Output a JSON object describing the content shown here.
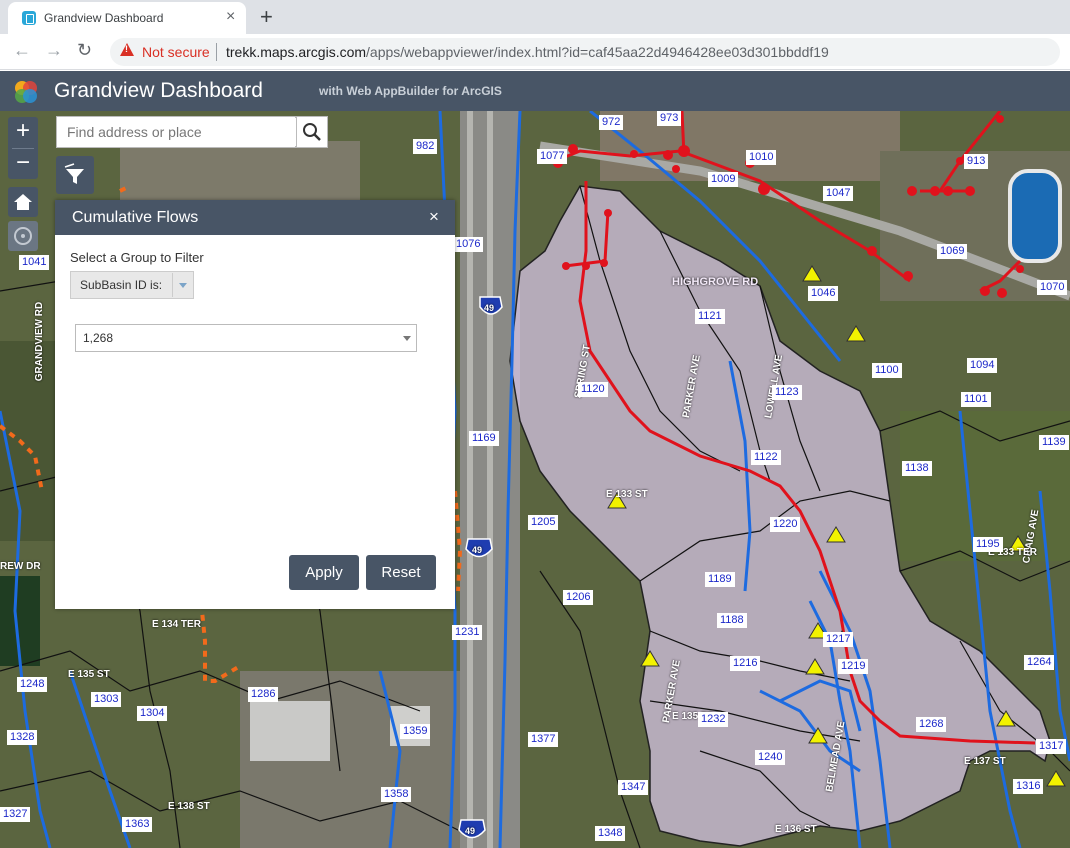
{
  "browser": {
    "tab_title": "Grandview Dashboard",
    "tab_close": "×",
    "new_tab": "+",
    "not_secure": "Not secure",
    "url_host": "trekk.maps.arcgis.com",
    "url_path": "/apps/webappviewer/index.html?id=caf45aa22d4946428ee03d301bbddf19",
    "back_icon": "arrow-left-icon",
    "forward_icon": "arrow-right-icon",
    "reload_icon": "reload-icon"
  },
  "header": {
    "title": "Grandview Dashboard",
    "subtitle": "with Web AppBuilder for ArcGIS"
  },
  "map_controls": {
    "zoom_in": "+",
    "zoom_out": "−",
    "search_placeholder": "Find address or place"
  },
  "panel": {
    "title": "Cumulative Flows",
    "close": "×",
    "group_label": "Select a Group to Filter",
    "group_value": "SubBasin ID is:",
    "value_selected": "1,268",
    "apply_label": "Apply",
    "reset_label": "Reset"
  },
  "map_labels": [
    "972",
    "982",
    "973",
    "1077",
    "1010",
    "1009",
    "1047",
    "913",
    "1069",
    "1046",
    "1070",
    "1076",
    "1041",
    "1121",
    "1120",
    "1123",
    "1100",
    "1094",
    "1101",
    "1169",
    "1122",
    "1138",
    "1139",
    "1220",
    "1205",
    "1195",
    "1189",
    "1206",
    "1188",
    "1217",
    "1216",
    "1219",
    "1231",
    "1264",
    "1248",
    "1303",
    "1304",
    "1286",
    "1232",
    "1268",
    "1359",
    "1328",
    "1377",
    "1240",
    "1317",
    "1358",
    "1316",
    "1347",
    "1363",
    "1348",
    "1327"
  ],
  "street_labels": [
    "HIGHGROVE RD",
    "E 133 ST",
    "E 134 TER",
    "E 135 ST",
    "E 136 ST",
    "PARKER AVE",
    "SPRING ST",
    "CRAIG AVE",
    "GRANDVIEW RD",
    "E 133 TER",
    "LOWELL AVE",
    "BELMEAD AVE",
    "PARKER AVE",
    "E 138 ST",
    "E 135 TER",
    "E 137 ST",
    "REW DR"
  ],
  "highways": [
    "49",
    "49",
    "49"
  ],
  "colors": {
    "header": "#485566",
    "basin_fill": "#d8c6e8",
    "flow_line": "#e0121c",
    "streams": "#1d6be0",
    "label_text": "#1c28c9",
    "triangle": "#f2f200"
  }
}
